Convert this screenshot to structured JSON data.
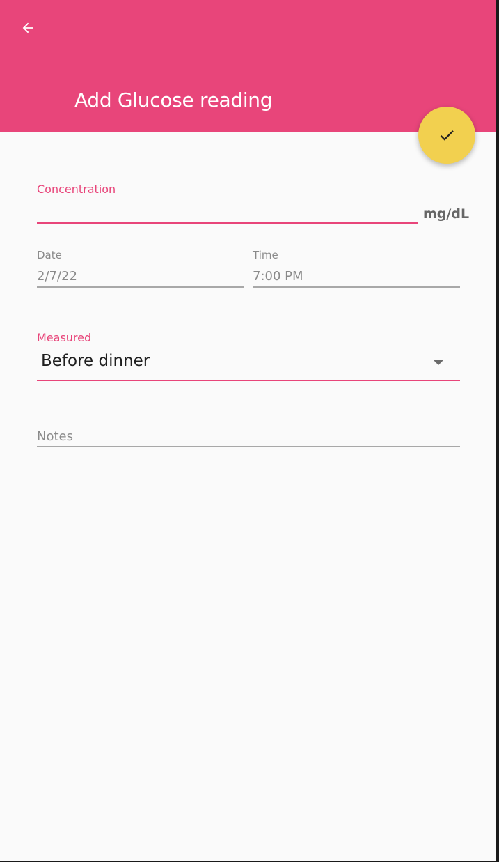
{
  "header": {
    "title": "Add Glucose reading",
    "back_icon": "arrow-left-icon",
    "confirm_icon": "check-icon",
    "bar_color": "#e8457a",
    "fab_color": "#f2d04f"
  },
  "form": {
    "concentration": {
      "label": "Concentration",
      "value": "",
      "unit": "mg/dL"
    },
    "date": {
      "label": "Date",
      "value": "2/7/22"
    },
    "time": {
      "label": "Time",
      "value": "7:00 PM"
    },
    "measured": {
      "label": "Measured",
      "value": "Before dinner"
    },
    "notes": {
      "placeholder": "Notes",
      "value": ""
    }
  }
}
